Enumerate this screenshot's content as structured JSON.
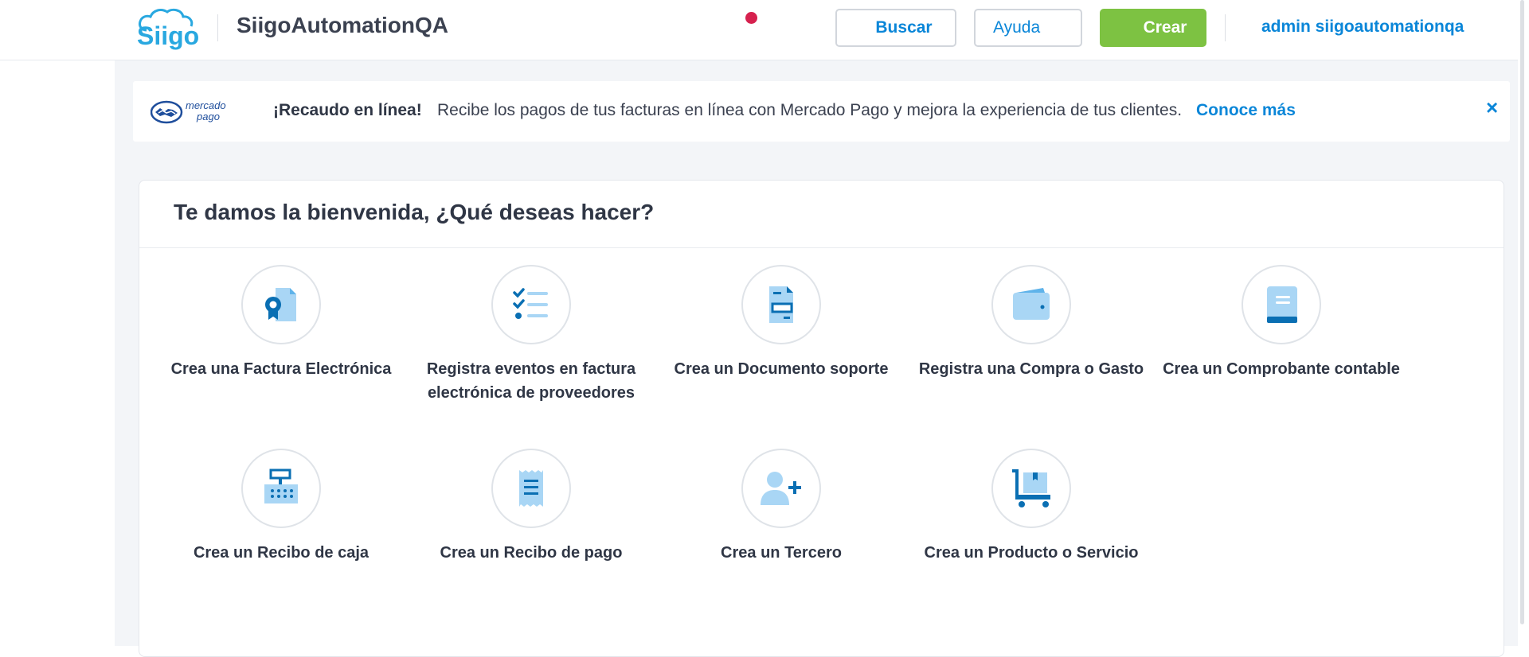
{
  "header": {
    "company_name": "SiigoAutomationQA",
    "search_label": "Buscar",
    "help_label": "Ayuda",
    "create_label": "Crear",
    "user_name": "admin siigoautomationqa",
    "brand_color": "#0a86d8",
    "create_color": "#7dc242",
    "notification_color": "#d6214e"
  },
  "banner": {
    "title": "¡Recaudo en línea!",
    "text": "Recibe los pagos de tus facturas en línea con Mercado Pago y mejora la experiencia de tus clientes.",
    "link_label": "Conoce más",
    "close_icon": "×"
  },
  "welcome": {
    "title": "Te damos la bienvenida, ¿Qué deseas hacer?",
    "actions": [
      {
        "label": "Crea una Factura Electrónica",
        "icon": "invoice-award-icon"
      },
      {
        "label": "Registra eventos en factura electrónica de proveedores",
        "icon": "checklist-icon"
      },
      {
        "label": "Crea un Documento soporte",
        "icon": "support-document-icon"
      },
      {
        "label": "Registra una Compra o Gasto",
        "icon": "wallet-icon"
      },
      {
        "label": "Crea un Comprobante contable",
        "icon": "ledger-book-icon"
      },
      {
        "label": "Crea un Recibo de caja",
        "icon": "cash-register-icon"
      },
      {
        "label": "Crea un Recibo de pago",
        "icon": "receipt-icon"
      },
      {
        "label": "Crea un Tercero",
        "icon": "add-person-icon"
      },
      {
        "label": "Crea un Producto o Servicio",
        "icon": "cart-box-icon"
      }
    ]
  }
}
